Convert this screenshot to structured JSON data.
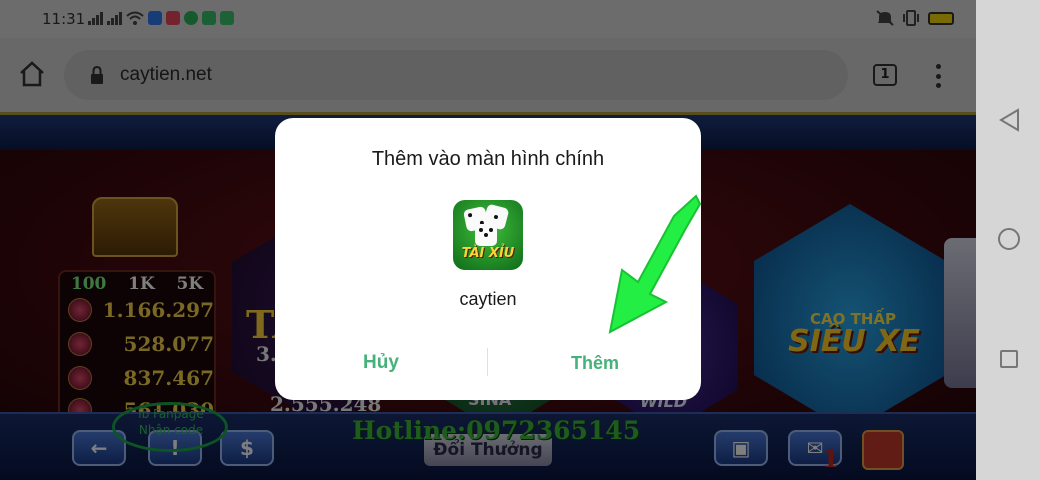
{
  "status_bar": {
    "time": "11:31",
    "app_icons": [
      "zalo",
      "pink-app",
      "green-app",
      "green-app-2",
      "chat-app"
    ],
    "battery_color": "#f2d40b"
  },
  "browser": {
    "url": "caytien.net",
    "tab_count": "1"
  },
  "game": {
    "jackpot": {
      "headers": [
        "100",
        "1K",
        "5K"
      ],
      "values": [
        "1.166.297",
        "528.077",
        "837.467",
        "561.030"
      ]
    },
    "tile_left_big": "TÀ",
    "tile_left_num1": "3.",
    "tile_left_num2": "2.555.248",
    "tile_sina": "SINA",
    "tile_wild": "WILD",
    "tile4_small": "CAO THẤP",
    "tile4_big": "SIÊU XE",
    "hotline": "Hotline:0972365145",
    "fanpage_text": "ib Fanpage Nhận code",
    "doi_thuong": "Đổi Thưởng",
    "red_number": "1"
  },
  "dialog": {
    "title": "Thêm vào màn hình chính",
    "icon_banner": "TÀI XỈU",
    "app_name": "caytien",
    "cancel": "Hủy",
    "add": "Thêm",
    "accent": "#46b17a"
  },
  "annotation": {
    "arrow_color": "#22ee44"
  }
}
